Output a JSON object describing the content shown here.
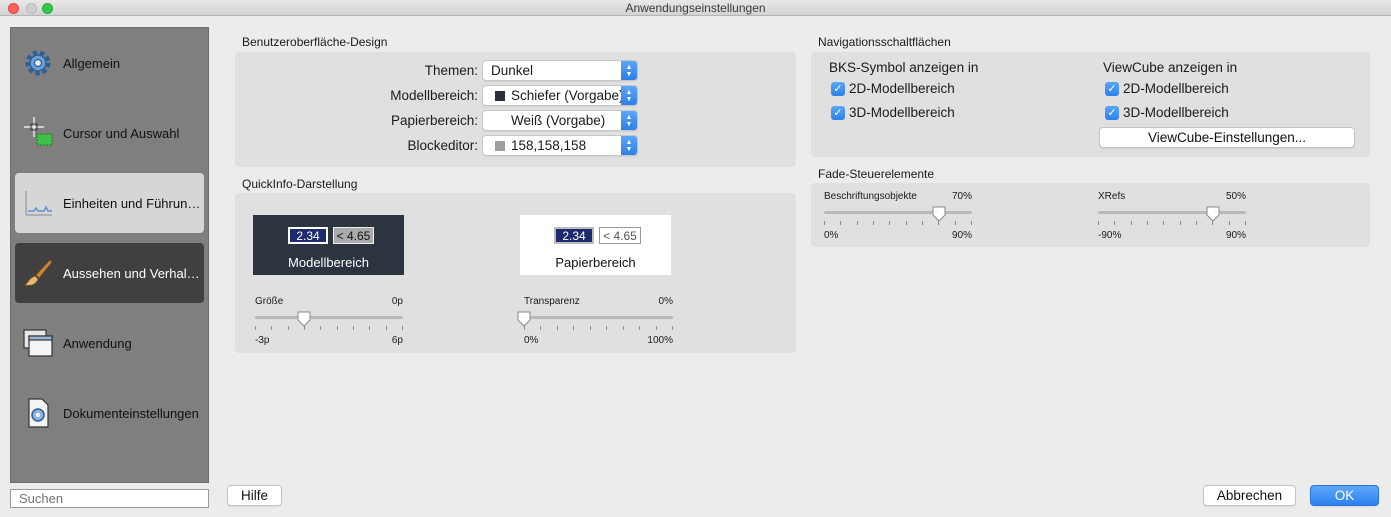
{
  "window": {
    "title": "Anwendungseinstellungen"
  },
  "sidebar": {
    "items": [
      {
        "label": "Allgemein",
        "icon": "gear-icon"
      },
      {
        "label": "Cursor und Auswahl",
        "icon": "crosshair-selection-icon"
      },
      {
        "label": "Einheiten und Führungslinien",
        "icon": "units-ruler-icon"
      },
      {
        "label": "Aussehen und Verhalten",
        "icon": "paintbrush-icon"
      },
      {
        "label": "Anwendung",
        "icon": "windows-stack-icon"
      },
      {
        "label": "Dokumenteinstellungen",
        "icon": "document-gear-icon"
      }
    ],
    "search_placeholder": "Suchen"
  },
  "ui_design": {
    "title": "Benutzeroberfläche-Design",
    "rows": [
      {
        "label": "Themen:",
        "value": "Dunkel",
        "swatch": ""
      },
      {
        "label": "Modellbereich:",
        "value": "Schiefer (Vorgabe)",
        "swatch": "#2b2f38"
      },
      {
        "label": "Papierbereich:",
        "value": "Weiß (Vorgabe)",
        "swatch": "#ffffff"
      },
      {
        "label": "Blockeditor:",
        "value": "158,158,158",
        "swatch": "#9e9e9e"
      }
    ]
  },
  "quickinfo": {
    "title": "QuickInfo-Darstellung",
    "model": {
      "value1": "2.34",
      "value2": "< 4.65",
      "label": "Modellbereich"
    },
    "paper": {
      "value1": "2.34",
      "value2": "< 4.65",
      "label": "Papierbereich"
    },
    "size_slider": {
      "title": "Größe",
      "value": "0p",
      "min": "-3p",
      "max": "6p",
      "fraction": 0.333
    },
    "transparency_slider": {
      "title": "Transparenz",
      "value": "0%",
      "min": "0%",
      "max": "100%",
      "fraction": 0
    }
  },
  "navigation": {
    "title": "Navigationsschaltflächen",
    "ucs": {
      "heading": "BKS-Symbol anzeigen in",
      "opt1": "2D-Modellbereich",
      "opt2": "3D-Modellbereich",
      "checked1": true,
      "checked2": true
    },
    "viewcube": {
      "heading": "ViewCube anzeigen in",
      "opt1": "2D-Modellbereich",
      "opt2": "3D-Modellbereich",
      "checked1": true,
      "checked2": true,
      "settings_button": "ViewCube-Einstellungen..."
    }
  },
  "fade": {
    "title": "Fade-Steuerelemente",
    "annotation": {
      "title": "Beschriftungsobjekte",
      "value": "70%",
      "min": "0%",
      "max": "90%",
      "fraction": 0.778
    },
    "xrefs": {
      "title": "XRefs",
      "value": "50%",
      "min": "-90%",
      "max": "90%",
      "fraction": 0.778
    }
  },
  "footer": {
    "help": "Hilfe",
    "cancel": "Abbrechen",
    "ok": "OK"
  },
  "colors": {
    "accent": "#2f7fe9",
    "sidebar_bg": "#7f7f7f",
    "active_nav": "#404040",
    "model_bg": "#2c3440"
  }
}
